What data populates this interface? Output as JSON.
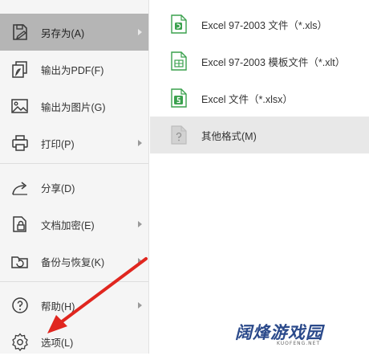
{
  "menu": {
    "items": [
      {
        "label": "另存为(A)",
        "icon": "save-as-icon",
        "active": true,
        "has_submenu": true
      },
      {
        "label": "输出为PDF(F)",
        "icon": "pdf-export-icon",
        "active": false,
        "has_submenu": false
      },
      {
        "label": "输出为图片(G)",
        "icon": "image-export-icon",
        "active": false,
        "has_submenu": false
      },
      {
        "label": "打印(P)",
        "icon": "printer-icon",
        "active": false,
        "has_submenu": true
      },
      {
        "label": "分享(D)",
        "icon": "share-icon",
        "active": false,
        "has_submenu": false
      },
      {
        "label": "文档加密(E)",
        "icon": "lock-icon",
        "active": false,
        "has_submenu": true
      },
      {
        "label": "备份与恢复(K)",
        "icon": "backup-icon",
        "active": false,
        "has_submenu": true
      },
      {
        "label": "帮助(H)",
        "icon": "help-icon",
        "active": false,
        "has_submenu": true
      },
      {
        "label": "选项(L)",
        "icon": "gear-icon",
        "active": false,
        "has_submenu": false
      }
    ]
  },
  "submenu": {
    "items": [
      {
        "label": "Excel 97-2003 文件（*.xls）",
        "icon": "excel-file-icon"
      },
      {
        "label": "Excel 97-2003 模板文件（*.xlt）",
        "icon": "excel-template-icon"
      },
      {
        "label": "Excel 文件（*.xlsx）",
        "icon": "excel-xlsx-icon"
      },
      {
        "label": "其他格式(M)",
        "icon": "other-format-icon"
      }
    ]
  },
  "watermark": {
    "text": "阔烽游戏园",
    "sub": "KUOFENG.NET"
  },
  "colors": {
    "menu_bg": "#f5f5f5",
    "active_bg": "#b5b5b5",
    "excel_green": "#3aa14d",
    "pointer_red": "#e0261f",
    "watermark_blue": "#2b4a8b"
  }
}
